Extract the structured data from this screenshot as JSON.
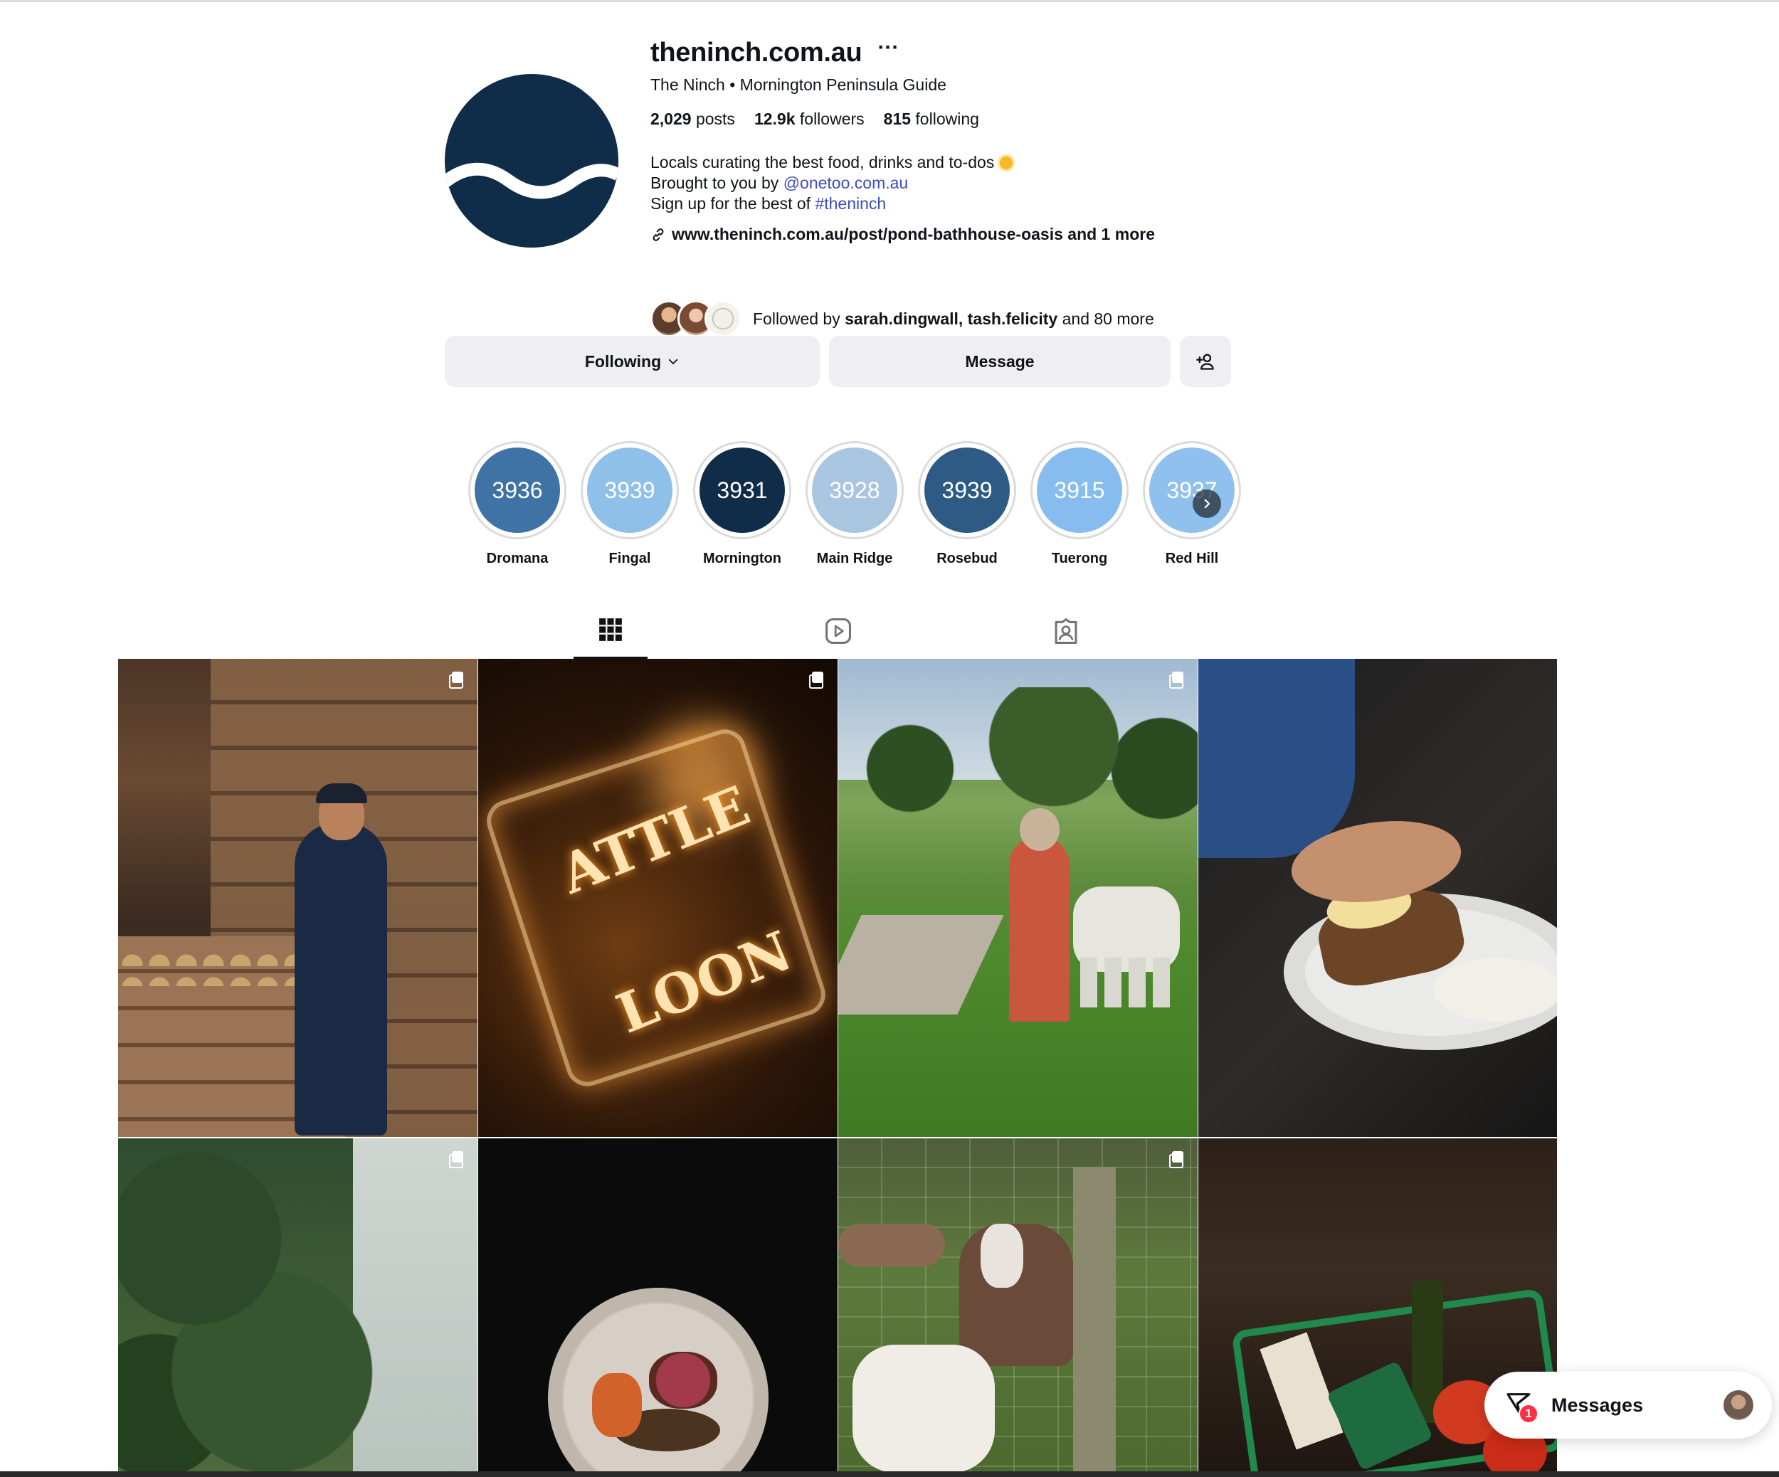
{
  "profile": {
    "username": "theninch.com.au",
    "full_name": "The Ninch • Mornington Peninsula Guide",
    "stats": {
      "posts_count": "2,029",
      "posts_label": "posts",
      "followers_count": "12.9k",
      "followers_label": "followers",
      "following_count": "815",
      "following_label": "following"
    },
    "bio": {
      "line1": "Locals curating the best food, drinks and to-dos",
      "line2_prefix": "Brought to you by ",
      "line2_mention": "@onetoo.com.au",
      "line3_prefix": "Sign up for the best of ",
      "line3_hashtag": "#theninch"
    },
    "link": "www.theninch.com.au/post/pond-bathhouse-oasis and 1 more",
    "followed_by": {
      "prefix": "Followed by ",
      "names": "sarah.dingwall, tash.felicity",
      "suffix": " and 80 more"
    },
    "avatar_color": "#0f2c48"
  },
  "actions": {
    "following_label": "Following",
    "message_label": "Message",
    "add_user_icon": "add-user-icon"
  },
  "highlights": [
    {
      "number": "3936",
      "label": "Dromana",
      "color": "#3f73a6"
    },
    {
      "number": "3939",
      "label": "Fingal",
      "color": "#8ec0ea"
    },
    {
      "number": "3931",
      "label": "Mornington",
      "color": "#0f2c48"
    },
    {
      "number": "3928",
      "label": "Main Ridge",
      "color": "#a8c6e0"
    },
    {
      "number": "3939",
      "label": "Rosebud",
      "color": "#2e5a86"
    },
    {
      "number": "3915",
      "label": "Tuerong",
      "color": "#86bdee"
    },
    {
      "number": "3937",
      "label": "Red Hill",
      "color": "#8fc0ee"
    }
  ],
  "tabs": [
    {
      "name": "posts",
      "icon": "grid-icon",
      "active": true
    },
    {
      "name": "reels",
      "icon": "reels-icon",
      "active": false
    },
    {
      "name": "tagged",
      "icon": "tagged-icon",
      "active": false
    }
  ],
  "posts": [
    {
      "subject": "farmer with potatoes",
      "carousel": true
    },
    {
      "subject": "neon saloon sign",
      "carousel": true
    },
    {
      "subject": "garden sculptures",
      "carousel": true
    },
    {
      "subject": "bread and butter",
      "carousel": false
    },
    {
      "subject": "pine trees",
      "carousel": true
    },
    {
      "subject": "steak dish",
      "carousel": false
    },
    {
      "subject": "goats at fence",
      "carousel": true
    },
    {
      "subject": "grocery basket",
      "carousel": false
    }
  ],
  "messages": {
    "label": "Messages",
    "badge": "1"
  }
}
